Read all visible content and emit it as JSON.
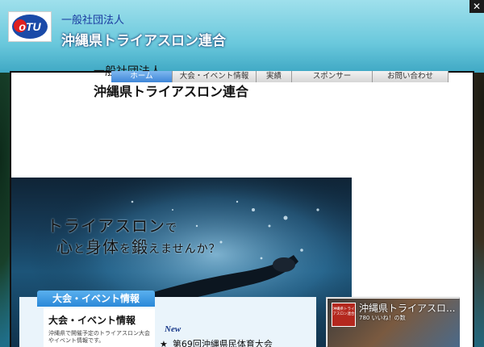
{
  "header": {
    "org_type": "一般社団法人",
    "org_name": "沖縄県トライアスロン連合",
    "logo_text": "oTU"
  },
  "close_label": "✕",
  "nav": {
    "items": [
      {
        "label": "ホーム",
        "active": true
      },
      {
        "label": "大会・イベント情報",
        "active": false
      },
      {
        "label": "実績",
        "active": false
      },
      {
        "label": "スポンサー",
        "active": false
      },
      {
        "label": "お問い合わせ",
        "active": false
      }
    ]
  },
  "frame_header": {
    "org_type": "一般社団法人",
    "org_name": "沖縄県トライアスロン連合"
  },
  "hero": {
    "line1_big": "トライアスロン",
    "line1_small": "で",
    "line2_a": "心",
    "line2_a_small": "と",
    "line2_b": "身体",
    "line2_b_small": "を",
    "line2_c": "鍛",
    "line2_c_small": "えませんか？"
  },
  "events": {
    "banner": "大会・イベント情報",
    "card_title": "大会・イベント情報",
    "card_desc": "沖縄県で開催予定のトライアスロン大会やイベント情報です。"
  },
  "news": {
    "new_label": "New",
    "star": "★",
    "item": "第69回沖縄県民体育大会"
  },
  "facebook": {
    "page_name": "沖縄県トライアスロ...",
    "likes": "780 いいね！の数",
    "thumb_text": "沖縄県トライアスロン連合"
  },
  "colors": {
    "accent_blue": "#2a88d8",
    "nav_active": "#3f86d8",
    "thumb_red": "#b4281e"
  }
}
